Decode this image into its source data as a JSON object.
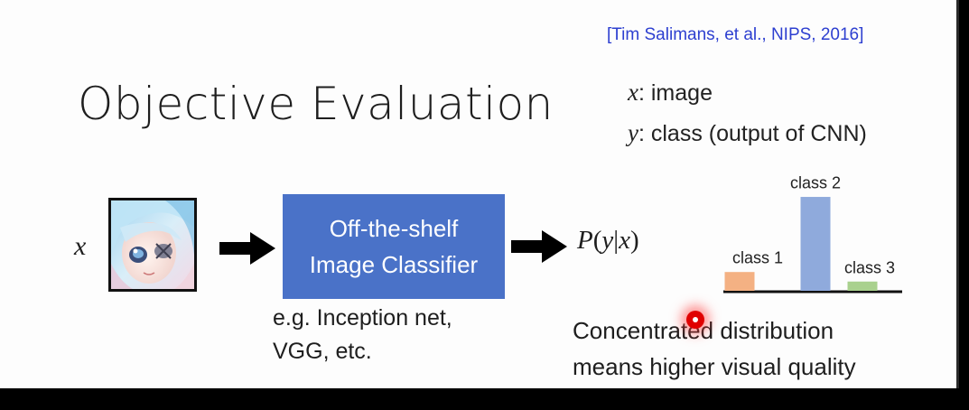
{
  "slide": {
    "citation": "[Tim Salimans, et al., NIPS, 2016]",
    "title": "Objective Evaluation",
    "definitions": {
      "x_var": "x",
      "x_text": ": image",
      "y_var": "y",
      "y_text": ": class (output of CNN)"
    },
    "input_var": "x",
    "classifier": {
      "line1": "Off-the-shelf",
      "line2": "Image Classifier",
      "note_line1": "e.g. Inception net,",
      "note_line2": "VGG, etc."
    },
    "probability": {
      "p": "P",
      "open": "(",
      "y": "y",
      "bar": "|",
      "x": "x",
      "close": ")"
    },
    "conclusion": {
      "line1": "Concentrated distribution",
      "line2": "means higher visual quality"
    },
    "colors": {
      "citation": "#2d3fd0",
      "classifier_bg": "#4a72c8",
      "bar_class1": "#f4b183",
      "bar_class2": "#8faadc",
      "bar_class3": "#a9d18e"
    }
  },
  "chart_data": {
    "type": "bar",
    "categories": [
      "class 1",
      "class 2",
      "class 3"
    ],
    "values": [
      0.15,
      0.78,
      0.07
    ],
    "xlabel": "",
    "ylabel": "",
    "ylim": [
      0,
      1
    ],
    "grid": false
  }
}
